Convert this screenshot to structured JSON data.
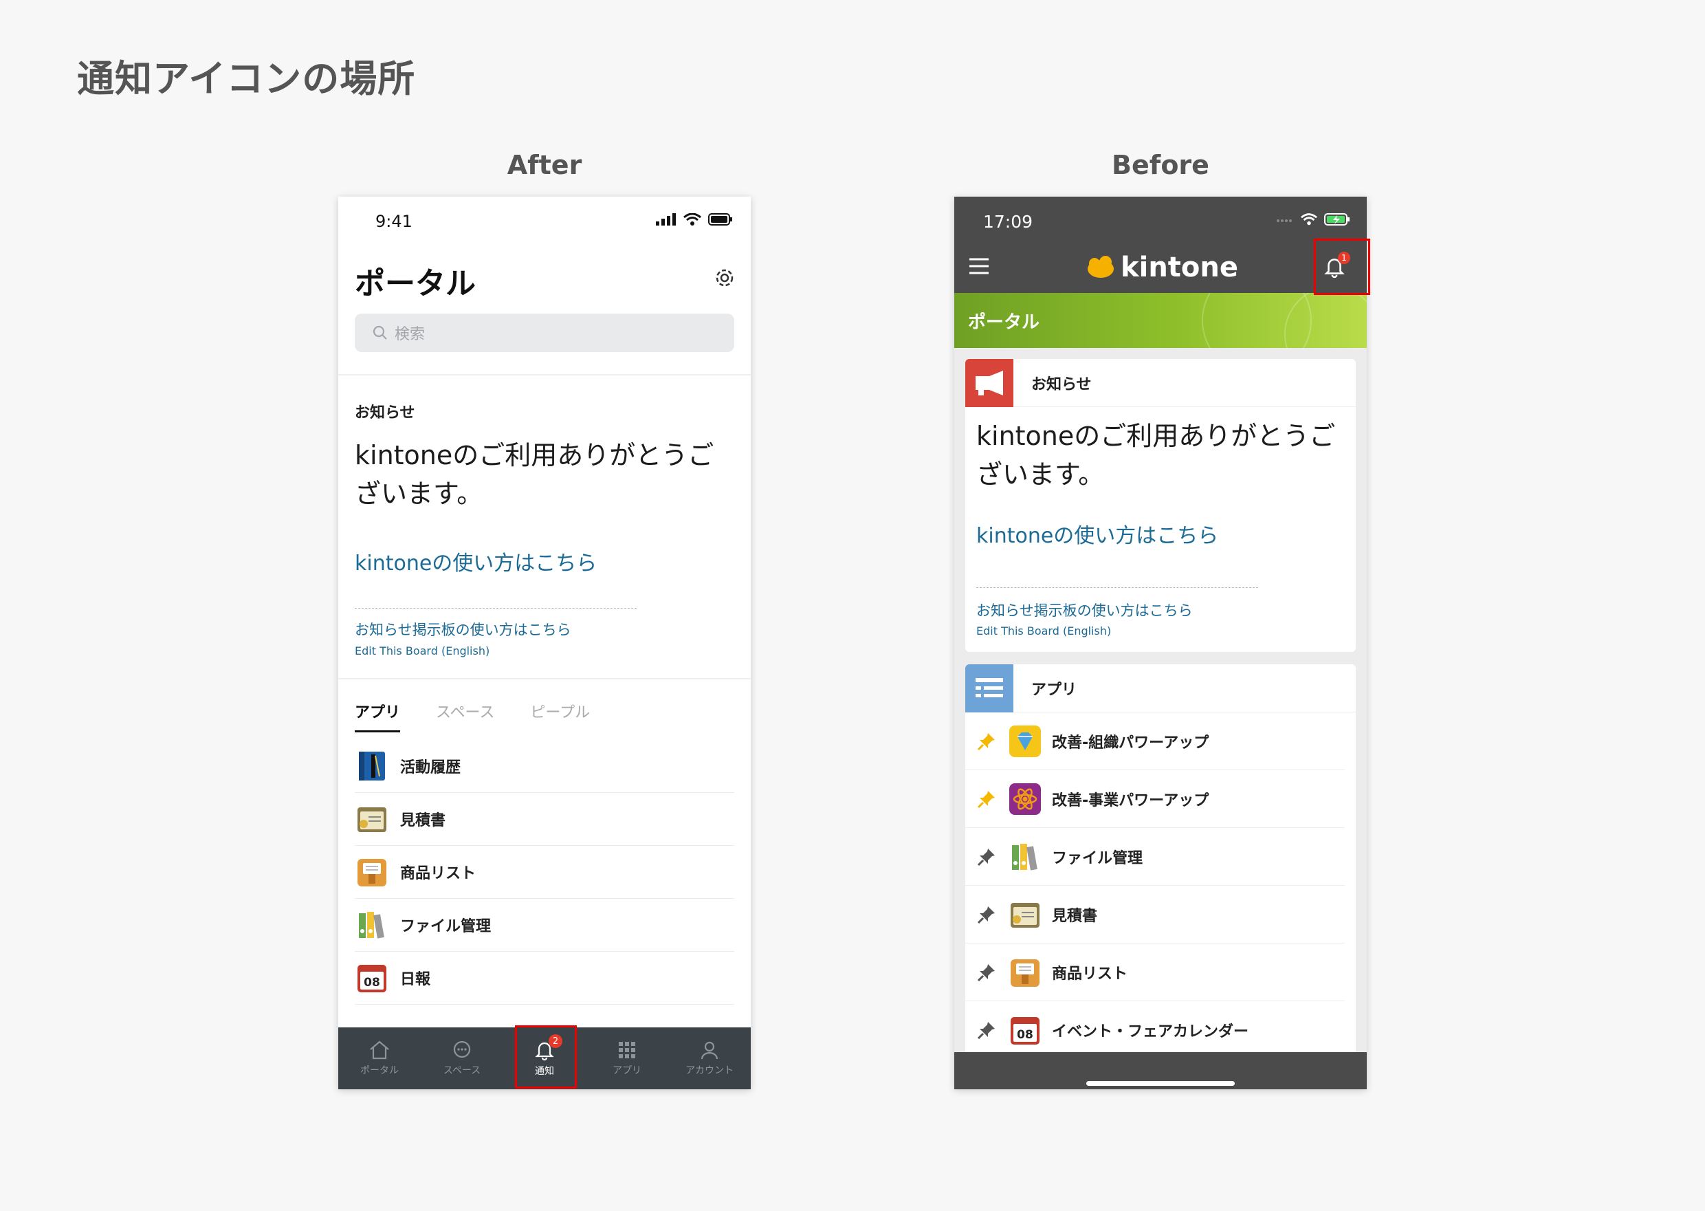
{
  "slide_title": "通知アイコンの場所",
  "labels": {
    "after": "After",
    "before": "Before"
  },
  "after": {
    "status_time": "9:41",
    "page_title": "ポータル",
    "search_placeholder": "検索",
    "notice_heading": "お知らせ",
    "notice_message": "kintoneのご利用ありがとうございます。",
    "notice_link": "kintoneの使い方はこちら",
    "board_link": "お知らせ掲示板の使い方はこちら",
    "board_edit": "Edit This Board (English)",
    "tabs": [
      "アプリ",
      "スペース",
      "ピープル"
    ],
    "apps": [
      {
        "name": "活動履歴",
        "icon": "notebook-icon"
      },
      {
        "name": "見積書",
        "icon": "estimate-icon"
      },
      {
        "name": "商品リスト",
        "icon": "product-box-icon"
      },
      {
        "name": "ファイル管理",
        "icon": "binders-icon"
      },
      {
        "name": "日報",
        "icon": "calendar-icon",
        "icon_text": "08"
      }
    ],
    "nav": [
      {
        "label": "ポータル",
        "icon": "home-icon"
      },
      {
        "label": "スペース",
        "icon": "chat-icon"
      },
      {
        "label": "通知",
        "icon": "bell-icon",
        "badge": "2"
      },
      {
        "label": "アプリ",
        "icon": "grid-icon"
      },
      {
        "label": "アカウント",
        "icon": "person-icon"
      }
    ]
  },
  "before": {
    "status_time": "17:09",
    "logo_text": "kintone",
    "bell_badge": "1",
    "banner_title": "ポータル",
    "notice_heading": "お知らせ",
    "notice_message": "kintoneのご利用ありがとうございます。",
    "notice_link": "kintoneの使い方はこちら",
    "board_link": "お知らせ掲示板の使い方はこちら",
    "board_edit": "Edit This Board (English)",
    "apps_heading": "アプリ",
    "apps": [
      {
        "name": "改善-組織パワーアップ",
        "icon": "diamond-icon",
        "pinned": true
      },
      {
        "name": "改善-事業パワーアップ",
        "icon": "atom-icon",
        "pinned": true
      },
      {
        "name": "ファイル管理",
        "icon": "binders-icon",
        "pinned": false
      },
      {
        "name": "見積書",
        "icon": "estimate-icon",
        "pinned": false
      },
      {
        "name": "商品リスト",
        "icon": "product-box-icon",
        "pinned": false
      },
      {
        "name": "イベント・フェアカレンダー",
        "icon": "calendar-icon",
        "icon_text": "08",
        "pinned": false
      }
    ]
  },
  "colors": {
    "link": "#1c6b96",
    "highlight_frame": "#ee0000",
    "badge": "#e83a2a",
    "nav_bar": "#3b4349",
    "header_dark": "#4b4b4b",
    "banner_green": "#8fc02b",
    "pin_active": "#f5b800"
  }
}
